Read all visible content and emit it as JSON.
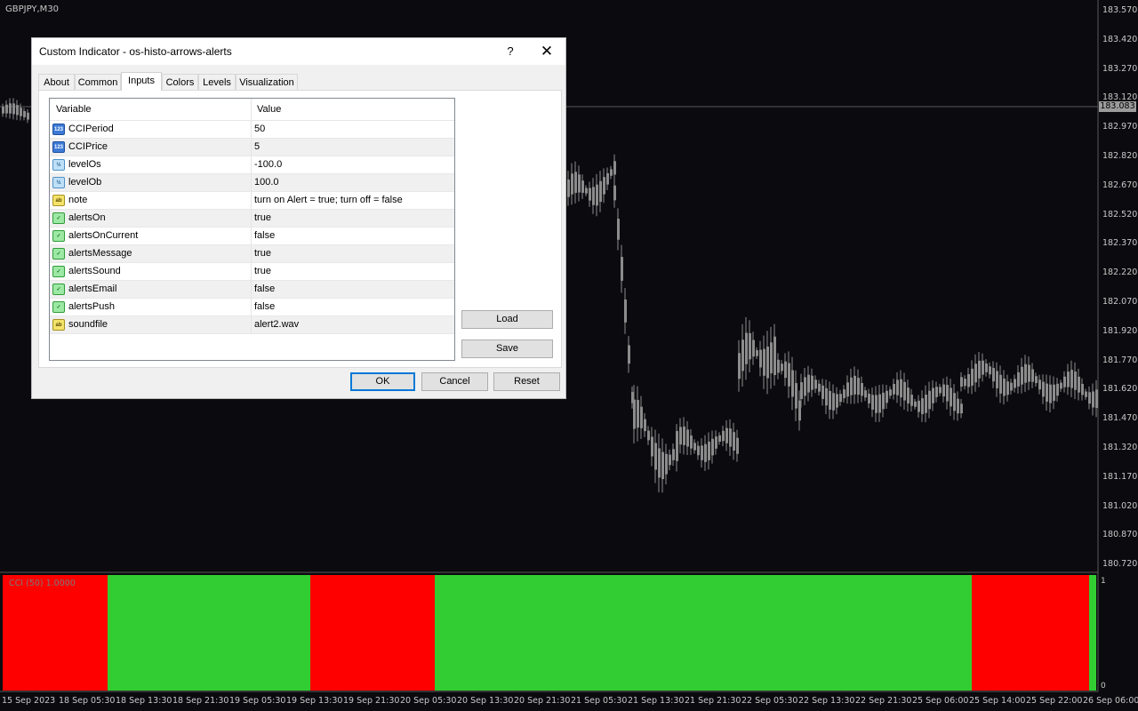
{
  "chart": {
    "symbol": "GBPJPY,M30",
    "current_price": "183.083",
    "price_labels": [
      "183.570",
      "183.420",
      "183.270",
      "183.120",
      "182.970",
      "182.820",
      "182.670",
      "182.520",
      "182.370",
      "182.220",
      "182.070",
      "181.920",
      "181.770",
      "181.620",
      "181.470",
      "181.320",
      "181.170",
      "181.020",
      "180.870",
      "180.720"
    ],
    "time_labels": [
      "15 Sep 2023",
      "18 Sep 05:30",
      "18 Sep 13:30",
      "18 Sep 21:30",
      "19 Sep 05:30",
      "19 Sep 13:30",
      "19 Sep 21:30",
      "20 Sep 05:30",
      "20 Sep 13:30",
      "20 Sep 21:30",
      "21 Sep 05:30",
      "21 Sep 13:30",
      "21 Sep 21:30",
      "22 Sep 05:30",
      "22 Sep 13:30",
      "22 Sep 21:30",
      "25 Sep 06:00",
      "25 Sep 14:00",
      "25 Sep 22:00",
      "26 Sep 06:00"
    ],
    "indicator_label": "CCI (50) 1.0000",
    "subwindow_max": "1",
    "subwindow_min": "0",
    "colors": {
      "background": "#0b0b0f",
      "candle": "#8c8c8c",
      "bull": "#32cd32",
      "bear": "#ff0000"
    },
    "histogram_segments": [
      {
        "state": "bear"
      },
      {
        "state": "bull"
      },
      {
        "state": "bear"
      },
      {
        "state": "bull"
      },
      {
        "state": "bear"
      },
      {
        "state": "bull"
      }
    ]
  },
  "dialog": {
    "title": "Custom Indicator - os-histo-arrows-alerts",
    "help_label": "?",
    "close_label": "✕",
    "tabs": [
      {
        "label": "About"
      },
      {
        "label": "Common"
      },
      {
        "label": "Inputs"
      },
      {
        "label": "Colors"
      },
      {
        "label": "Levels"
      },
      {
        "label": "Visualization"
      }
    ],
    "active_tab": "Inputs",
    "table": {
      "headers": [
        "Variable",
        "Value"
      ],
      "rows": [
        {
          "icon": "int",
          "icon_text": "123",
          "variable": "CCIPeriod",
          "value": "50"
        },
        {
          "icon": "int",
          "icon_text": "123",
          "variable": "CCIPrice",
          "value": "5"
        },
        {
          "icon": "dbl",
          "icon_text": "½",
          "variable": "levelOs",
          "value": "-100.0"
        },
        {
          "icon": "dbl",
          "icon_text": "½",
          "variable": "levelOb",
          "value": "100.0"
        },
        {
          "icon": "str",
          "icon_text": "ab",
          "variable": "note",
          "value": "turn on Alert = true; turn off = false"
        },
        {
          "icon": "bool",
          "icon_text": "✓",
          "variable": "alertsOn",
          "value": "true"
        },
        {
          "icon": "bool",
          "icon_text": "✓",
          "variable": "alertsOnCurrent",
          "value": "false"
        },
        {
          "icon": "bool",
          "icon_text": "✓",
          "variable": "alertsMessage",
          "value": "true"
        },
        {
          "icon": "bool",
          "icon_text": "✓",
          "variable": "alertsSound",
          "value": "true"
        },
        {
          "icon": "bool",
          "icon_text": "✓",
          "variable": "alertsEmail",
          "value": "false"
        },
        {
          "icon": "bool",
          "icon_text": "✓",
          "variable": "alertsPush",
          "value": "false"
        },
        {
          "icon": "str",
          "icon_text": "ab",
          "variable": "soundfile",
          "value": "alert2.wav"
        }
      ]
    },
    "buttons": {
      "load": "Load",
      "save": "Save",
      "ok": "OK",
      "cancel": "Cancel",
      "reset": "Reset"
    }
  }
}
